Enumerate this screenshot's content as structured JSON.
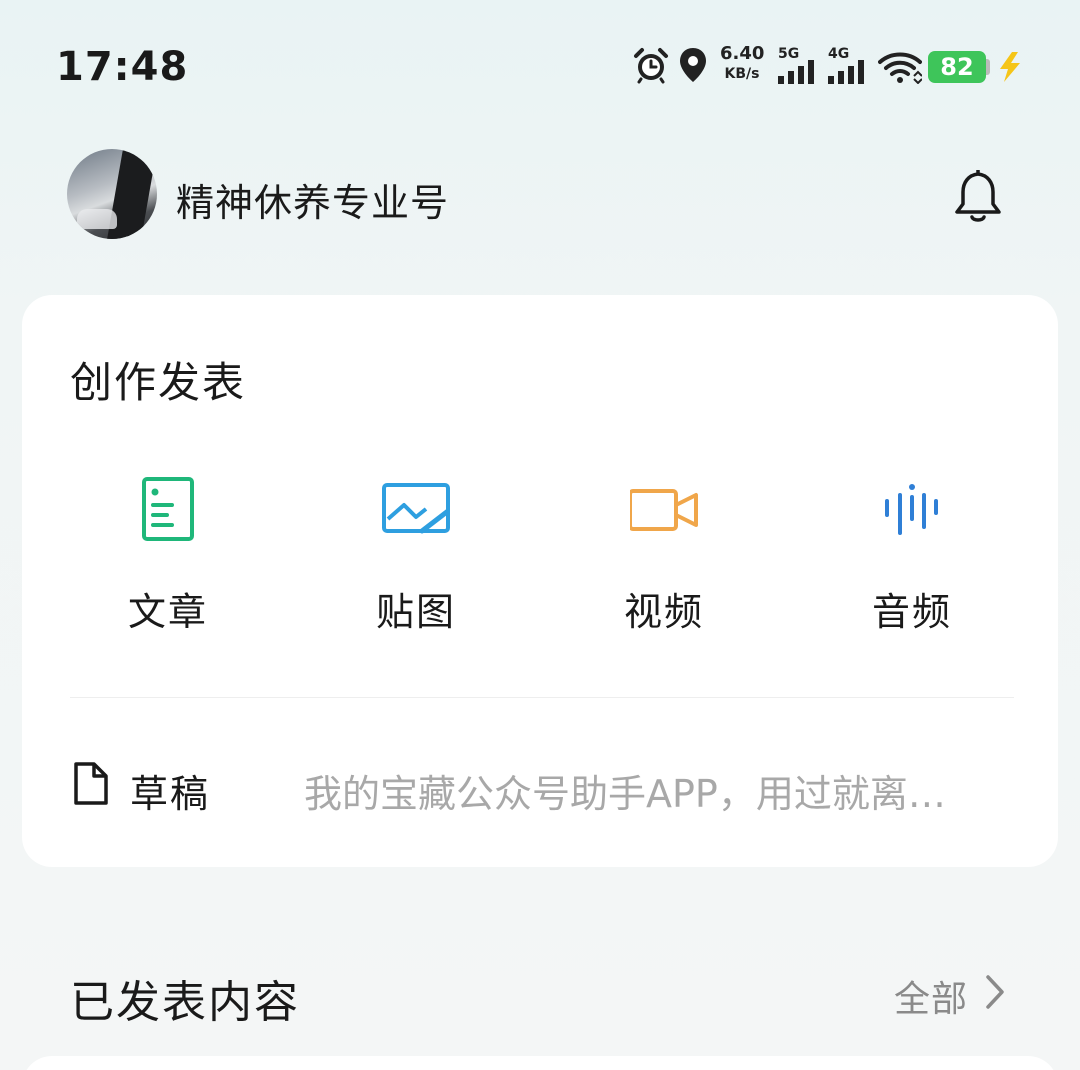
{
  "status_bar": {
    "time": "17:48",
    "net_speed_value": "6.40",
    "net_speed_unit": "KB/s",
    "signal_1_label": "5G",
    "signal_2_label": "4G",
    "battery_level": "82",
    "icons": [
      "alarm-icon",
      "location-icon",
      "signal-5g-icon",
      "signal-4g-icon",
      "wifi-icon",
      "battery-icon",
      "charging-icon"
    ]
  },
  "header": {
    "account_name": "精神休养专业号",
    "icons": [
      "avatar",
      "bell-icon"
    ]
  },
  "create": {
    "title": "创作发表",
    "tools": [
      {
        "label": "文章",
        "icon": "article-icon",
        "color": "#1fb77a"
      },
      {
        "label": "贴图",
        "icon": "image-post-icon",
        "color": "#2e9fe0"
      },
      {
        "label": "视频",
        "icon": "video-icon",
        "color": "#f0a64a"
      },
      {
        "label": "音频",
        "icon": "audio-icon",
        "color": "#2f7fd6"
      }
    ],
    "draft": {
      "label": "草稿",
      "preview": "我的宝藏公众号助手APP，用过就离…",
      "icon": "document-icon"
    }
  },
  "published": {
    "title": "已发表内容",
    "view_all": "全部",
    "icon": "chevron-right-icon"
  }
}
